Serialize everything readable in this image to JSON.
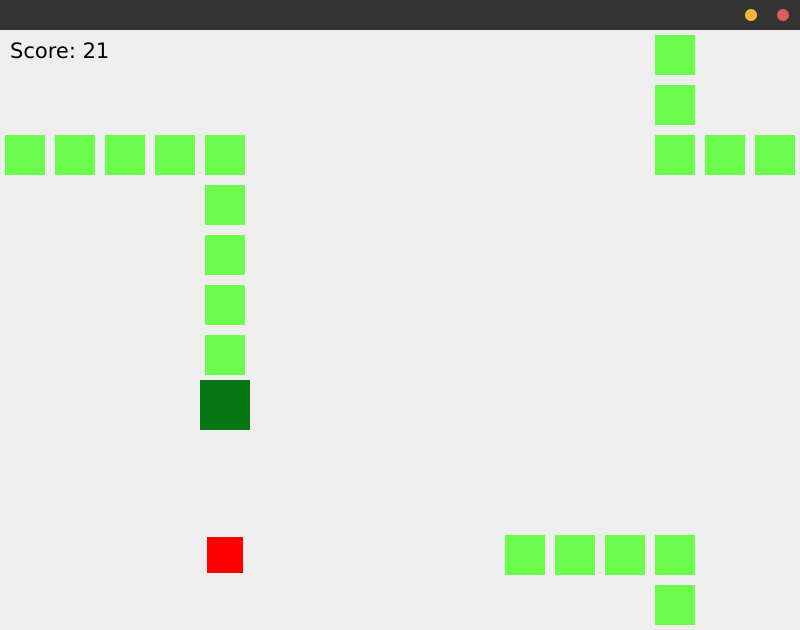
{
  "colors": {
    "titlebar": "#333333",
    "background": "#eeeeee",
    "minimize_button": "#f1b83b",
    "close_button": "#e05a5a",
    "snake_body": "#6cfc4e",
    "snake_head": "#067513",
    "food": "#ff0000"
  },
  "window": {
    "buttons": [
      {
        "name": "minimize",
        "icon": "minimize-dot-icon"
      },
      {
        "name": "close",
        "icon": "close-dot-icon"
      }
    ]
  },
  "hud": {
    "score_text": "Score: 21"
  },
  "game": {
    "grid_size": 50,
    "snake": {
      "head": [
        4,
        7
      ],
      "body": [
        [
          4,
          6
        ],
        [
          4,
          5
        ],
        [
          4,
          4
        ],
        [
          4,
          3
        ],
        [
          4,
          2
        ],
        [
          3,
          2
        ],
        [
          2,
          2
        ],
        [
          1,
          2
        ],
        [
          0,
          2
        ],
        [
          15,
          2
        ],
        [
          14,
          2
        ],
        [
          13,
          2
        ],
        [
          13,
          1
        ],
        [
          13,
          0
        ],
        [
          13,
          11
        ],
        [
          13,
          10
        ],
        [
          12,
          10
        ],
        [
          11,
          10
        ],
        [
          10,
          10
        ]
      ]
    },
    "food": [
      4,
      10
    ]
  }
}
